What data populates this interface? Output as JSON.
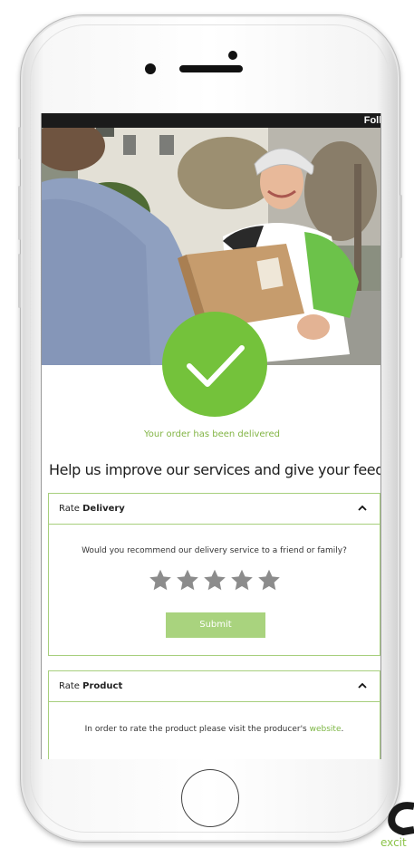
{
  "status_bar": {
    "follow_label": "Follo"
  },
  "hero": {
    "alt": "courier delivering parcel"
  },
  "confirmation": {
    "message": "Your order has been delivered",
    "heading": "Help us improve our services and give your feedback."
  },
  "delivery_card": {
    "prefix": "Rate",
    "title": "Delivery",
    "question": "Would you recommend our delivery service to a friend or family?",
    "rating": 0,
    "max_rating": 5,
    "submit_label": "Submit"
  },
  "product_card": {
    "prefix": "Rate",
    "title": "Product",
    "note_before": "In order to rate the product please visit the producer's",
    "link_label": "website",
    "note_after": "."
  },
  "brand": {
    "tagline_fragment": "excit"
  },
  "colors": {
    "accent_green": "#74c23b",
    "submit_green": "#a9d37e",
    "border_green": "#a7cf7d",
    "star_gray": "#8c8c8c"
  }
}
